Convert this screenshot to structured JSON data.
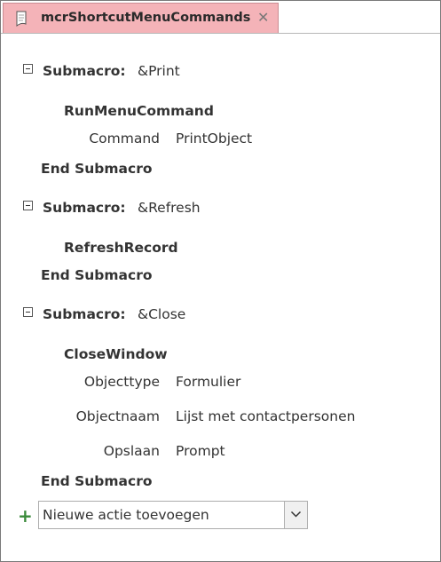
{
  "tab": {
    "title": "mcrShortcutMenuCommands",
    "close_glyph": "✕",
    "icon": "document-icon"
  },
  "submacros": [
    {
      "keyword": "Submacro:",
      "name": "&Print",
      "actions": [
        {
          "name": "RunMenuCommand",
          "args": [
            {
              "label": "Command",
              "value": "PrintObject"
            }
          ]
        }
      ],
      "end": "End Submacro"
    },
    {
      "keyword": "Submacro:",
      "name": "&Refresh",
      "actions": [
        {
          "name": "RefreshRecord",
          "args": []
        }
      ],
      "end": "End Submacro"
    },
    {
      "keyword": "Submacro:",
      "name": "&Close",
      "actions": [
        {
          "name": "CloseWindow",
          "args": [
            {
              "label": "Objecttype",
              "value": "Formulier"
            },
            {
              "label": "Objectnaam",
              "value": "Lijst met contactpersonen"
            },
            {
              "label": "Opslaan",
              "value": "Prompt"
            }
          ]
        }
      ],
      "end": "End Submacro"
    }
  ],
  "add_action": {
    "plus": "+",
    "placeholder": "Nieuwe actie toevoegen"
  }
}
